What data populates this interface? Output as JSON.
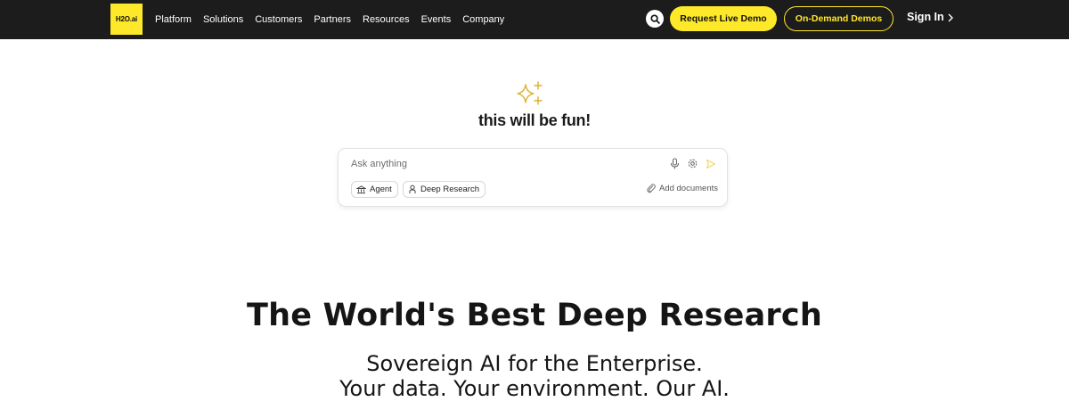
{
  "nav": {
    "logo_text": "H2O.ai",
    "links": [
      "Platform",
      "Solutions",
      "Customers",
      "Partners",
      "Resources",
      "Events",
      "Company"
    ],
    "search_icon": "search-icon",
    "request_demo_label": "Request Live Demo",
    "on_demand_label": "On-Demand Demos",
    "sign_in_label": "Sign In",
    "accent_color": "#fee82a",
    "bar_color": "#1c1c1c"
  },
  "hero": {
    "sparkle_icon": "sparkle-icon",
    "title": "this will be fun!",
    "ask": {
      "placeholder": "Ask anything",
      "agent_label": "Agent",
      "deep_research_label": "Deep Research",
      "add_documents_label": "Add documents",
      "icons": [
        "microphone-icon",
        "settings-icon",
        "send-icon"
      ]
    }
  },
  "headline": {
    "title": "The World's Best Deep Research",
    "sub1": "Sovereign AI for the Enterprise.",
    "sub2": "Your data. Your environment. Our AI."
  }
}
